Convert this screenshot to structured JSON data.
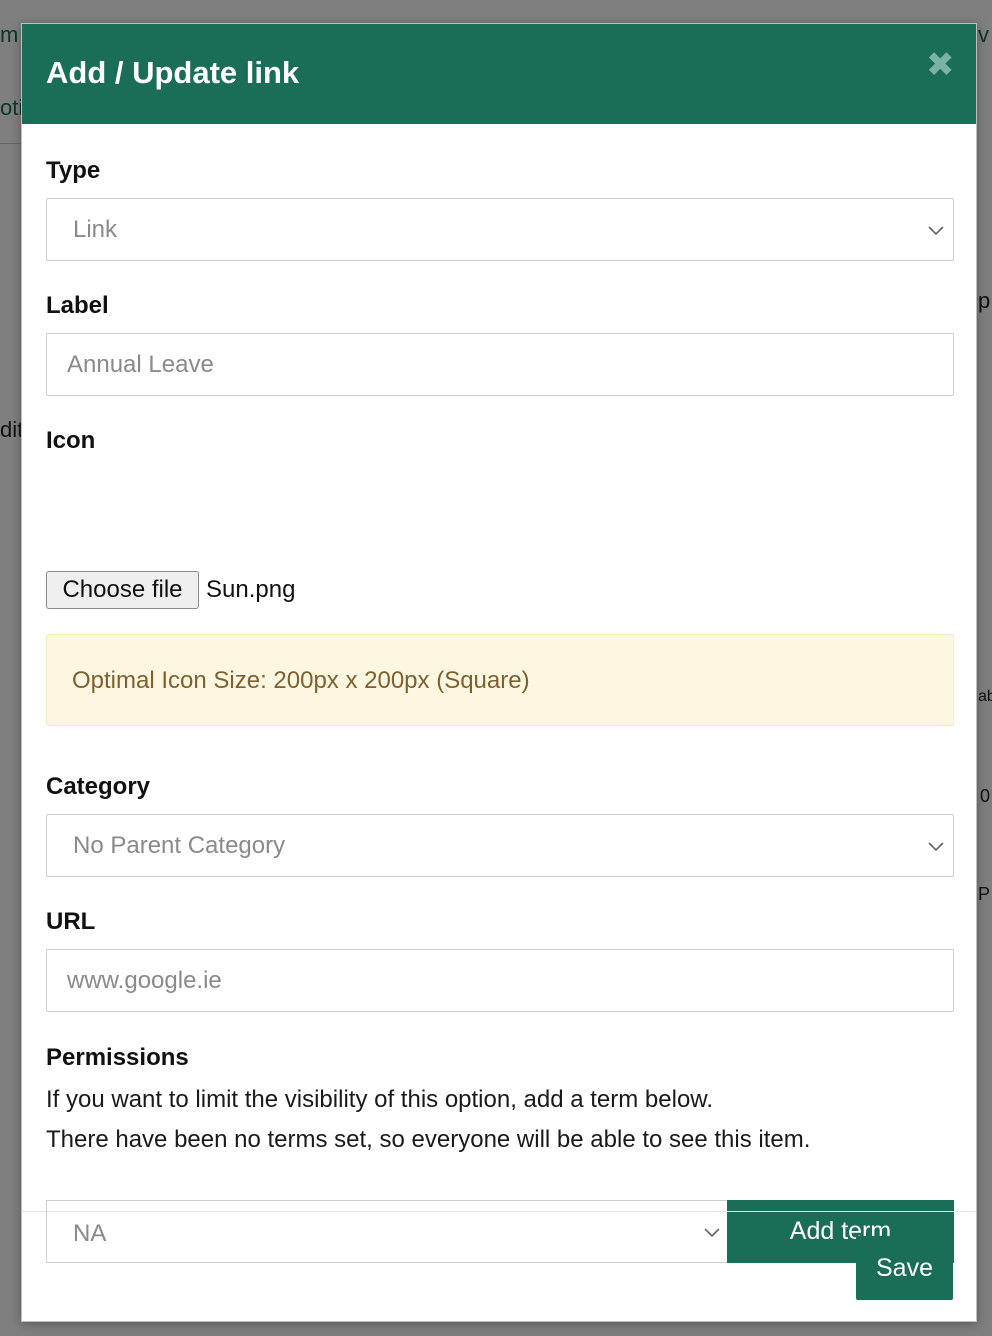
{
  "background": {
    "fragments": [
      "m",
      "v",
      "oti",
      "p",
      "dit",
      "ab",
      "0",
      "P"
    ]
  },
  "modal": {
    "title": "Add / Update link",
    "close_icon": "close-icon",
    "fields": {
      "type": {
        "label": "Type",
        "value": "Link"
      },
      "label": {
        "label": "Label",
        "placeholder": "Annual Leave"
      },
      "icon": {
        "label": "Icon",
        "choose_file_label": "Choose file",
        "file_name": "Sun.png",
        "hint": "Optimal Icon Size: 200px x 200px (Square)"
      },
      "category": {
        "label": "Category",
        "value": "No Parent Category"
      },
      "url": {
        "label": "URL",
        "placeholder": "www.google.ie"
      }
    },
    "permissions": {
      "label": "Permissions",
      "line1": "If you want to limit the visibility of this option, add a term below.",
      "line2": "There have been no terms set, so everyone will be able to see this item.",
      "term_value": "NA",
      "add_term_label": "Add term"
    },
    "footer": {
      "save_label": "Save"
    }
  },
  "colors": {
    "brand": "#1a6e58",
    "alert_bg": "#fdf6e0",
    "alert_text": "#7e6130"
  }
}
